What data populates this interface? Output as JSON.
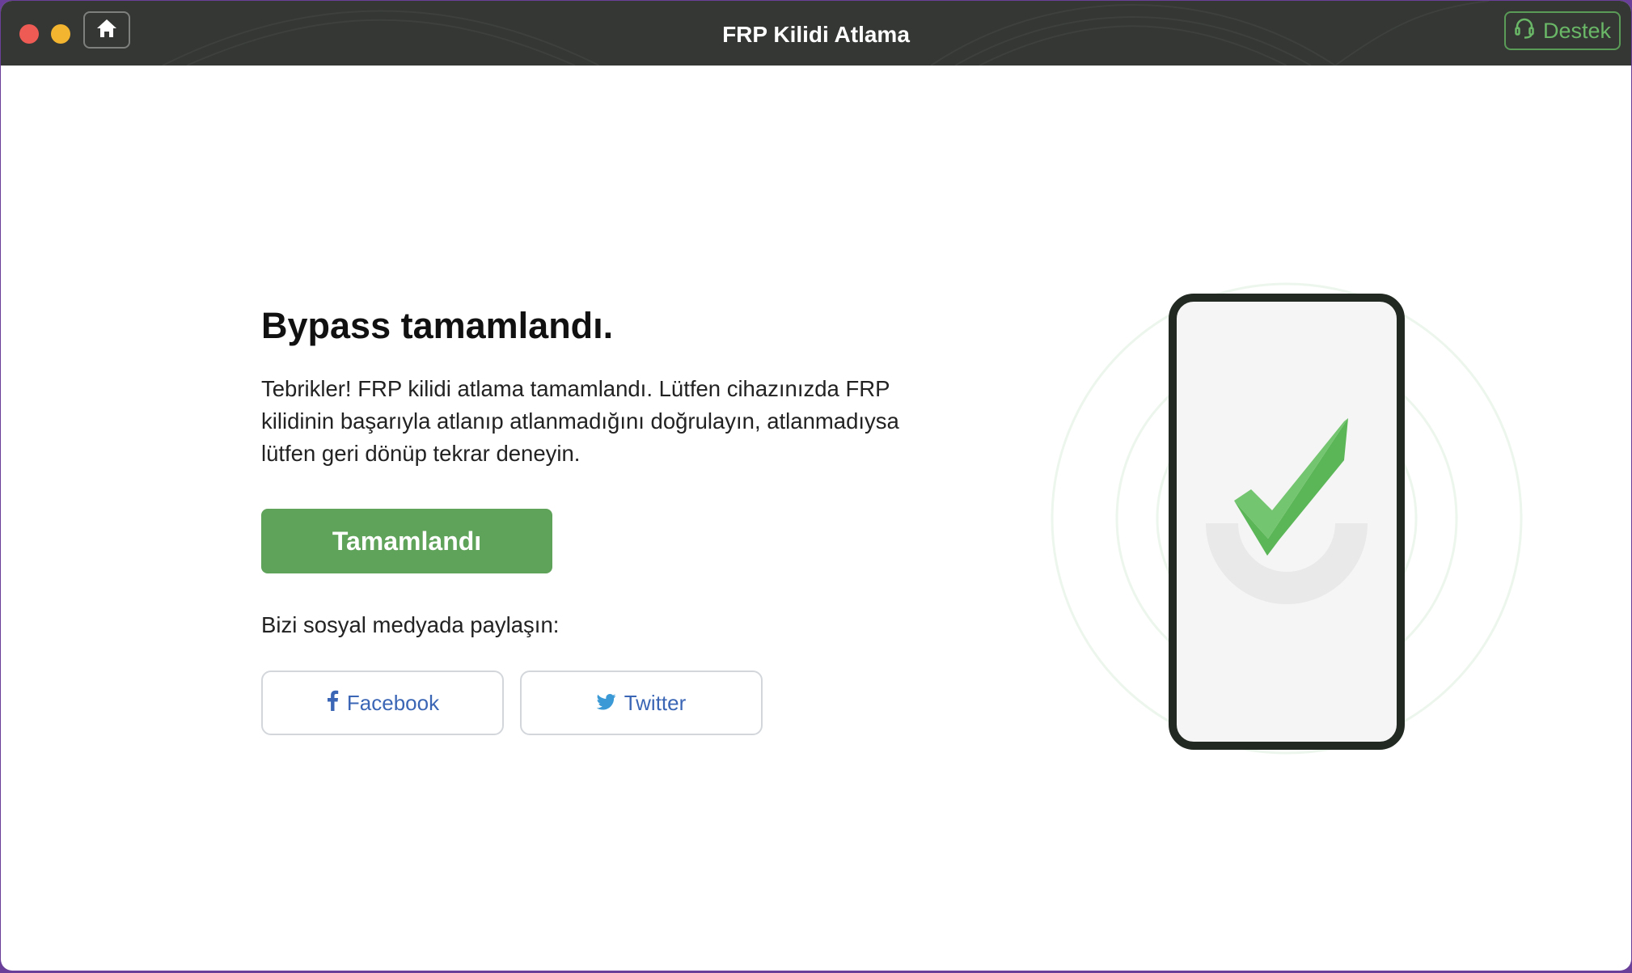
{
  "window": {
    "title": "FRP Kilidi Atlama",
    "support_label": "Destek"
  },
  "main": {
    "heading": "Bypass tamamlandı.",
    "message": "Tebrikler! FRP kilidi atlama tamamlandı. Lütfen cihazınızda FRP kilidinin başarıyla atlanıp atlanmadığını doğrulayın, atlanmadıysa lütfen geri dönüp tekrar deneyin.",
    "done_button": "Tamamlandı",
    "share_label": "Bizi sosyal medyada paylaşın:",
    "social": {
      "facebook": "Facebook",
      "twitter": "Twitter"
    }
  },
  "colors": {
    "titlebar": "#343734",
    "accent_green": "#5fa25a",
    "support_green": "#6ab867",
    "social_blue": "#3b66b5",
    "close": "#ee5b55",
    "minimize": "#f3b52f"
  },
  "icons": {
    "home": "home-icon",
    "support": "headset-icon",
    "facebook": "facebook-icon",
    "twitter": "twitter-icon",
    "success": "checkmark-icon"
  }
}
